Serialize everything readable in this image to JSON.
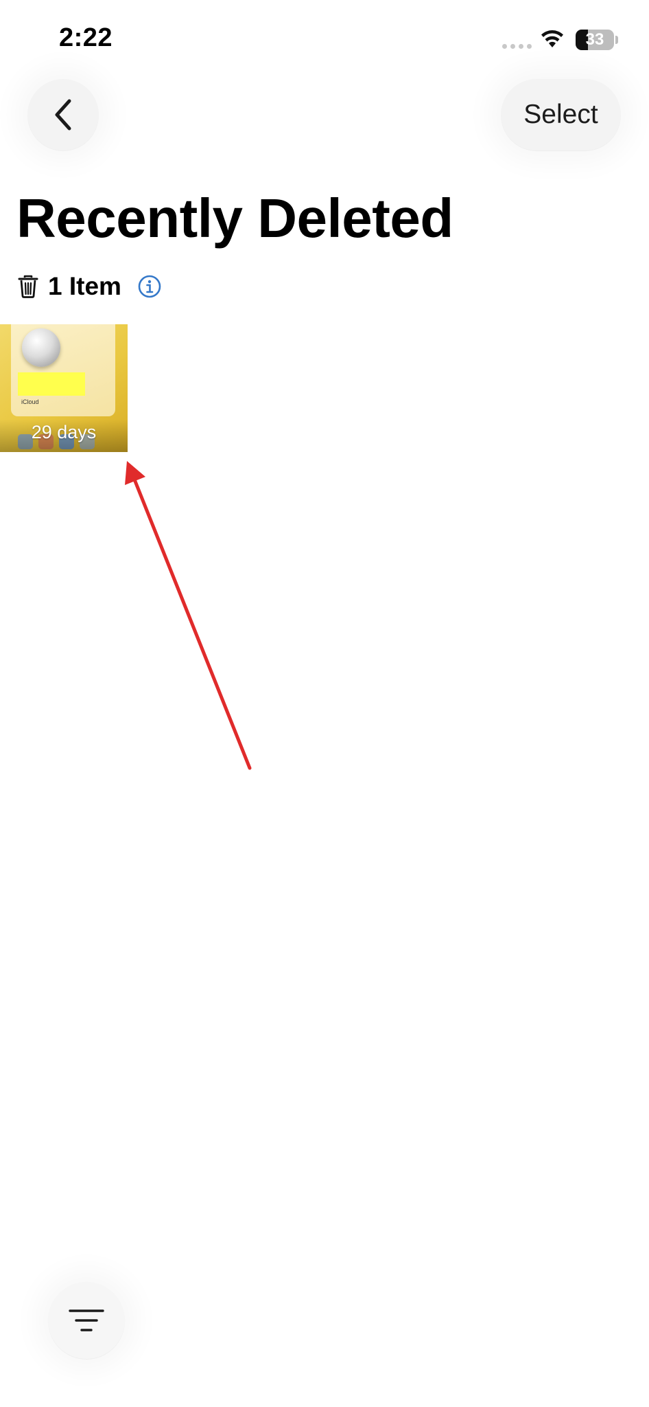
{
  "status_bar": {
    "time": "2:22",
    "battery_percent": "33",
    "battery_level": 0.33,
    "icons": [
      "signal-dots-icon",
      "wifi-icon",
      "battery-icon"
    ]
  },
  "nav": {
    "back_icon": "chevron-left-icon",
    "select_label": "Select"
  },
  "header": {
    "title": "Recently Deleted",
    "item_count": "1 Item",
    "trash_icon": "trash-icon",
    "info_icon": "info-icon"
  },
  "items": [
    {
      "days_remaining": "29 days",
      "caption": "iCloud"
    }
  ],
  "toolbar": {
    "filter_icon": "filter-icon"
  },
  "colors": {
    "accent": "#3478c9",
    "annotation": "#e02b2b",
    "button_bg": "#f3f3f3"
  }
}
